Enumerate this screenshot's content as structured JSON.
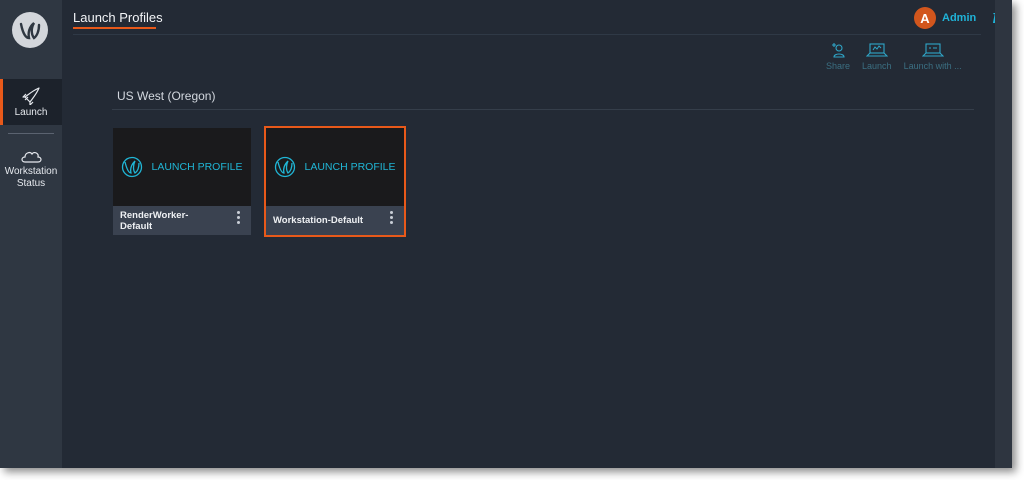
{
  "header": {
    "title": "Launch Profiles"
  },
  "user": {
    "initial": "A",
    "name": "Admin"
  },
  "info_glyph": "i",
  "sidebar": {
    "items": [
      {
        "label": "Launch"
      },
      {
        "label_line1": "Workstation",
        "label_line2": "Status"
      }
    ]
  },
  "toolbar": {
    "share_label": "Share",
    "launch_label": "Launch",
    "launch_with_label": "Launch with ..."
  },
  "region": {
    "name": "US West (Oregon)"
  },
  "cards": [
    {
      "banner": "LAUNCH PROFILE",
      "name_line1": "RenderWorker-",
      "name_line2": "Default"
    },
    {
      "banner": "LAUNCH PROFILE",
      "name_line1": "Workstation-Default",
      "name_line2": ""
    }
  ],
  "colors": {
    "accent": "#e8591a",
    "link": "#1fb3d8",
    "background": "#232a35",
    "sidebar": "#2f3742"
  }
}
